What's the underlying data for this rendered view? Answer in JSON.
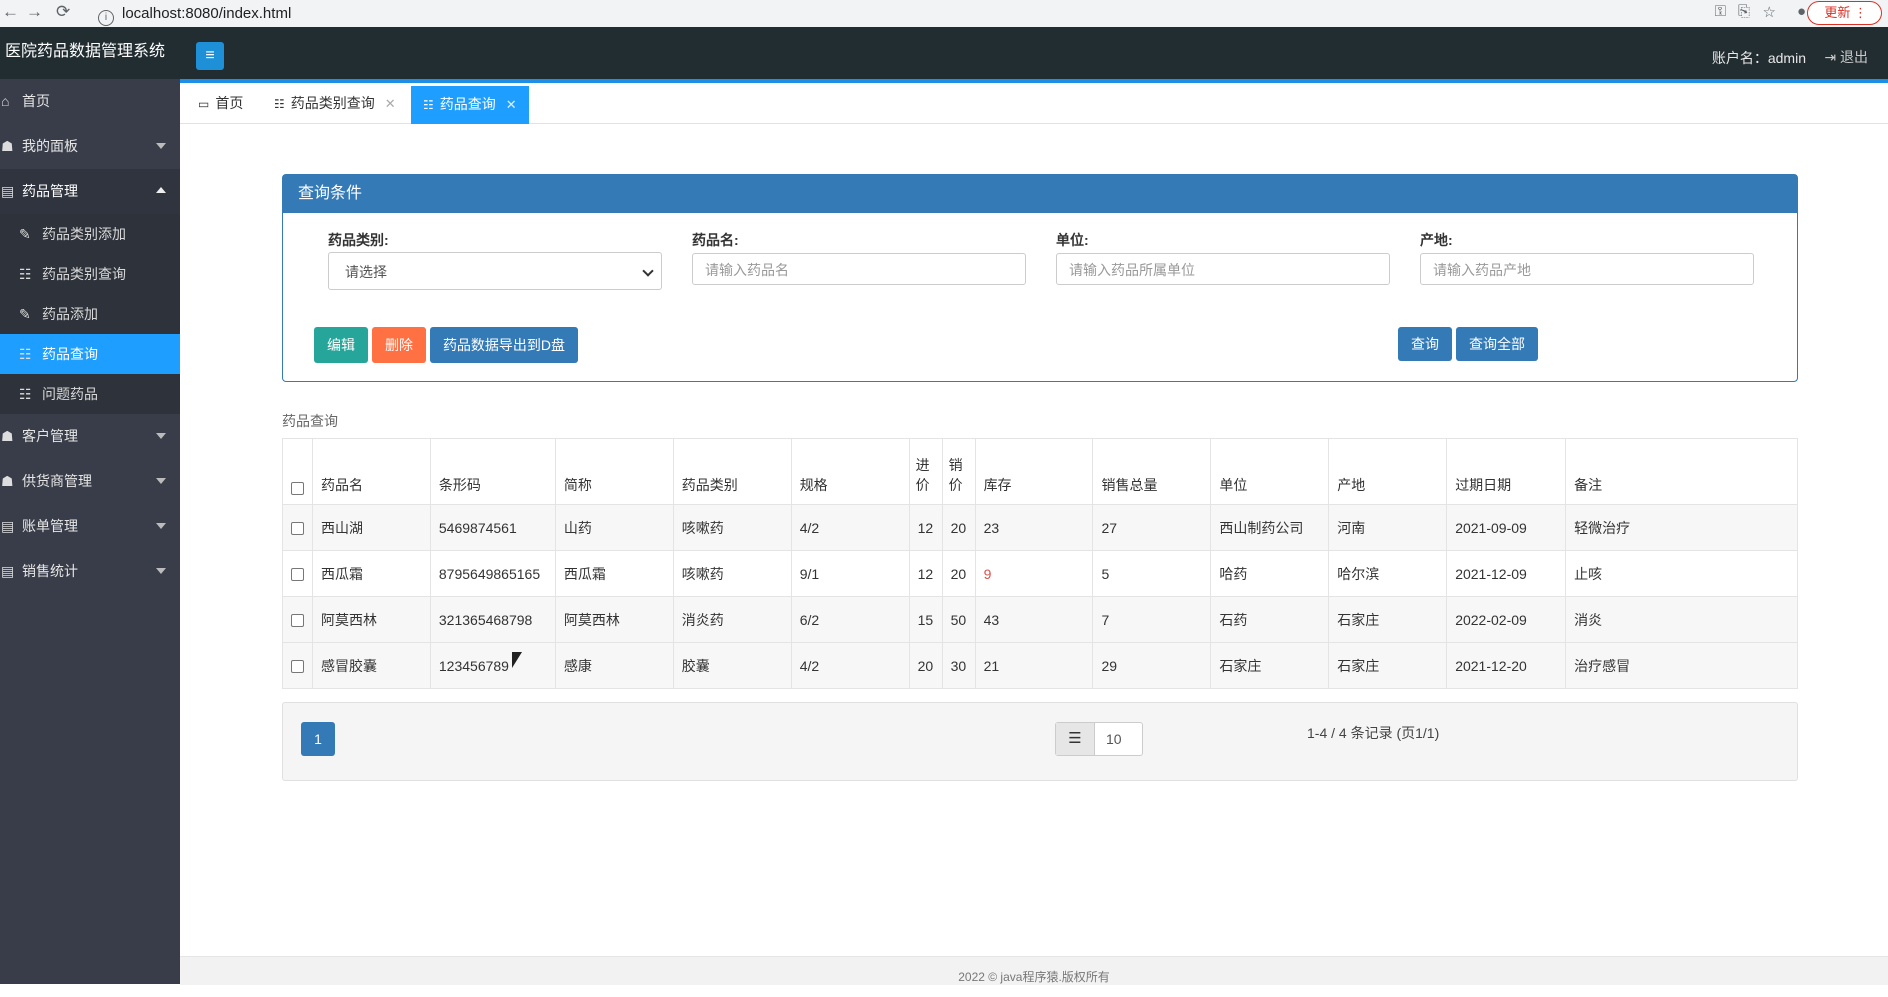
{
  "browser": {
    "url": "localhost:8080/index.html",
    "update_label": "更新"
  },
  "header": {
    "brand": "医院药品数据管理系统",
    "account_label": "账户名：admin",
    "logout_label": "退出"
  },
  "sidebar": {
    "items": [
      {
        "label": "首页",
        "icon": "home-icon"
      },
      {
        "label": "我的面板",
        "icon": "user-icon"
      },
      {
        "label": "药品管理",
        "icon": "document-icon"
      },
      {
        "label": "药品类别添加",
        "icon": "edit-icon"
      },
      {
        "label": "药品类别查询",
        "icon": "list-icon"
      },
      {
        "label": "药品添加",
        "icon": "edit-icon"
      },
      {
        "label": "药品查询",
        "icon": "list-icon"
      },
      {
        "label": "问题药品",
        "icon": "list-icon"
      },
      {
        "label": "客户管理",
        "icon": "users-icon"
      },
      {
        "label": "供货商管理",
        "icon": "users-icon"
      },
      {
        "label": "账单管理",
        "icon": "document-icon"
      },
      {
        "label": "销售统计",
        "icon": "document-icon"
      }
    ]
  },
  "tabs": [
    {
      "label": "首页",
      "icon": "monitor-icon"
    },
    {
      "label": "药品类别查询",
      "icon": "list-icon"
    },
    {
      "label": "药品查询",
      "icon": "list-icon"
    }
  ],
  "query": {
    "title": "查询条件",
    "category_label": "药品类别:",
    "category_value": "请选择",
    "name_label": "药品名:",
    "name_placeholder": "请输入药品名",
    "unit_label": "单位:",
    "unit_placeholder": "请输入药品所属单位",
    "origin_label": "产地:",
    "origin_placeholder": "请输入药品产地",
    "edit_btn": "编辑",
    "delete_btn": "删除",
    "export_btn": "药品数据导出到D盘",
    "search_btn": "查询",
    "search_all_btn": "查询全部",
    "colors": {
      "edit": "#26a69a",
      "delete": "#ff7043",
      "primary": "#337ab7"
    }
  },
  "table": {
    "title": "药品查询",
    "headers": {
      "name": "药品名",
      "barcode": "条形码",
      "short": "简称",
      "category": "药品类别",
      "spec": "规格",
      "buy_price_1": "进",
      "buy_price_2": "价",
      "sell_price_1": "销",
      "sell_price_2": "价",
      "stock": "库存",
      "sales": "销售总量",
      "unit": "单位",
      "origin": "产地",
      "expiry": "过期日期",
      "remark": "备注"
    },
    "rows": [
      {
        "name": "西山湖",
        "barcode": "5469874561",
        "short": "山药",
        "category": "咳嗽药",
        "spec": "4/2",
        "buy": "12",
        "sell": "20",
        "stock": "23",
        "sales": "27",
        "unit": "西山制药公司",
        "origin": "河南",
        "expiry": "2021-09-09",
        "remark": "轻微治疗"
      },
      {
        "name": "西瓜霜",
        "barcode": "8795649865165",
        "short": "西瓜霜",
        "category": "咳嗽药",
        "spec": "9/1",
        "buy": "12",
        "sell": "20",
        "stock": "9",
        "sales": "5",
        "unit": "哈药",
        "origin": "哈尔滨",
        "expiry": "2021-12-09",
        "remark": "止咳"
      },
      {
        "name": "阿莫西林",
        "barcode": "321365468798",
        "short": "阿莫西林",
        "category": "消炎药",
        "spec": "6/2",
        "buy": "15",
        "sell": "50",
        "stock": "43",
        "sales": "7",
        "unit": "石药",
        "origin": "石家庄",
        "expiry": "2022-02-09",
        "remark": "消炎"
      },
      {
        "name": "感冒胶囊",
        "barcode": "123456789",
        "short": "感康",
        "category": "胶囊",
        "spec": "4/2",
        "buy": "20",
        "sell": "30",
        "stock": "21",
        "sales": "29",
        "unit": "石家庄",
        "origin": "石家庄",
        "expiry": "2021-12-20",
        "remark": "治疗感冒"
      }
    ],
    "low_stock_color": "#d9534f"
  },
  "pager": {
    "page": "1",
    "page_size": "10",
    "info": "1-4 / 4 条记录 (页1/1)"
  },
  "footer": "2022 © java程序猿.版权所有"
}
